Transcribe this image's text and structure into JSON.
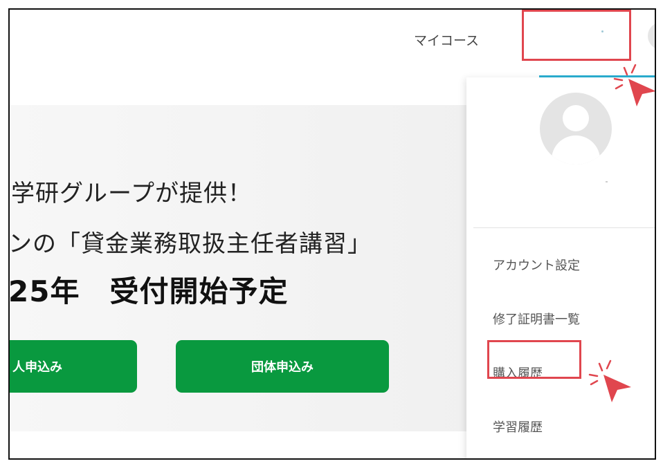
{
  "header": {
    "nav_mycourse": "マイコース"
  },
  "hero": {
    "line1": "学研グループが提供！",
    "line2": "ンの「貸金業務取扱主任者講習」",
    "line3": "25年　受付開始予定",
    "btn_individual": "人申込み",
    "btn_group": "団体申込み"
  },
  "dropdown": {
    "items": [
      {
        "label": "アカウント設定"
      },
      {
        "label": "修了証明書一覧"
      },
      {
        "label": "購入履歴"
      },
      {
        "label": "学習履歴"
      }
    ]
  },
  "colors": {
    "accent_underline": "#2bb0d3",
    "button_green": "#09993f",
    "highlight_red": "#e0464e"
  },
  "icons": {
    "avatar": "user-avatar-icon",
    "pointer": "cursor-arrow-icon"
  }
}
